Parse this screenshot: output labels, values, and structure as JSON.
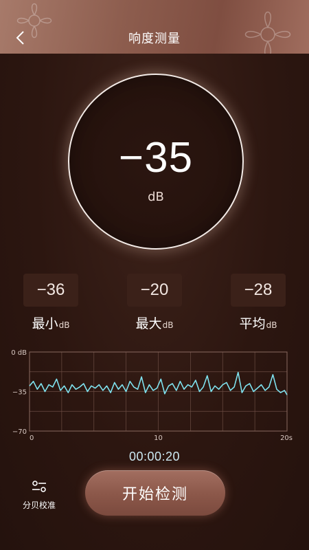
{
  "header": {
    "title": "响度测量",
    "back_icon": "chevron-left-icon"
  },
  "meter": {
    "value": "−35",
    "unit": "dB"
  },
  "stats": [
    {
      "value": "−36",
      "label": "最小",
      "unit": "dB"
    },
    {
      "value": "−20",
      "label": "最大",
      "unit": "dB"
    },
    {
      "value": "−28",
      "label": "平均",
      "unit": "dB"
    }
  ],
  "chart_data": {
    "type": "line",
    "xlim": [
      0,
      20
    ],
    "ylim": [
      -70,
      0
    ],
    "x_ticks": [
      "0",
      "10",
      "20s"
    ],
    "y_ticks": [
      "0 dB",
      "−35",
      "−70"
    ],
    "grid": true,
    "series": [
      {
        "color": "#7fe3f0",
        "x": [
          0,
          0.3,
          0.6,
          0.9,
          1.2,
          1.5,
          1.8,
          2.1,
          2.4,
          2.7,
          3.0,
          3.3,
          3.6,
          3.9,
          4.2,
          4.5,
          4.8,
          5.1,
          5.4,
          5.7,
          6.0,
          6.3,
          6.6,
          6.9,
          7.2,
          7.5,
          7.8,
          8.1,
          8.4,
          8.7,
          9.0,
          9.3,
          9.6,
          9.9,
          10.2,
          10.5,
          10.8,
          11.1,
          11.4,
          11.7,
          12.0,
          12.3,
          12.6,
          12.9,
          13.2,
          13.5,
          13.8,
          14.1,
          14.4,
          14.7,
          15.0,
          15.3,
          15.6,
          15.9,
          16.2,
          16.5,
          16.8,
          17.1,
          17.4,
          17.7,
          18.0,
          18.3,
          18.6,
          18.9,
          19.2,
          19.5,
          19.8,
          20.0
        ],
        "y": [
          -30,
          -26,
          -33,
          -28,
          -35,
          -29,
          -31,
          -24,
          -34,
          -30,
          -36,
          -29,
          -33,
          -31,
          -28,
          -35,
          -30,
          -32,
          -29,
          -34,
          -30,
          -36,
          -27,
          -33,
          -29,
          -35,
          -26,
          -31,
          -33,
          -22,
          -36,
          -29,
          -34,
          -32,
          -24,
          -37,
          -30,
          -28,
          -34,
          -26,
          -33,
          -29,
          -31,
          -25,
          -35,
          -31,
          -21,
          -35,
          -30,
          -33,
          -29,
          -27,
          -34,
          -31,
          -18,
          -36,
          -30,
          -28,
          -35,
          -32,
          -29,
          -34,
          -31,
          -20,
          -33,
          -36,
          -34,
          -38
        ]
      }
    ]
  },
  "timer": "00:00:20",
  "bottom": {
    "calibrate_label": "分贝校准",
    "calibrate_icon": "sliders-icon",
    "start_label": "开始检测"
  },
  "colors": {
    "header": "#8d5d4e",
    "background": "#2c1610",
    "stat_box": "#3b2119",
    "waveform": "#7fe3f0",
    "button": "#8b5749"
  }
}
